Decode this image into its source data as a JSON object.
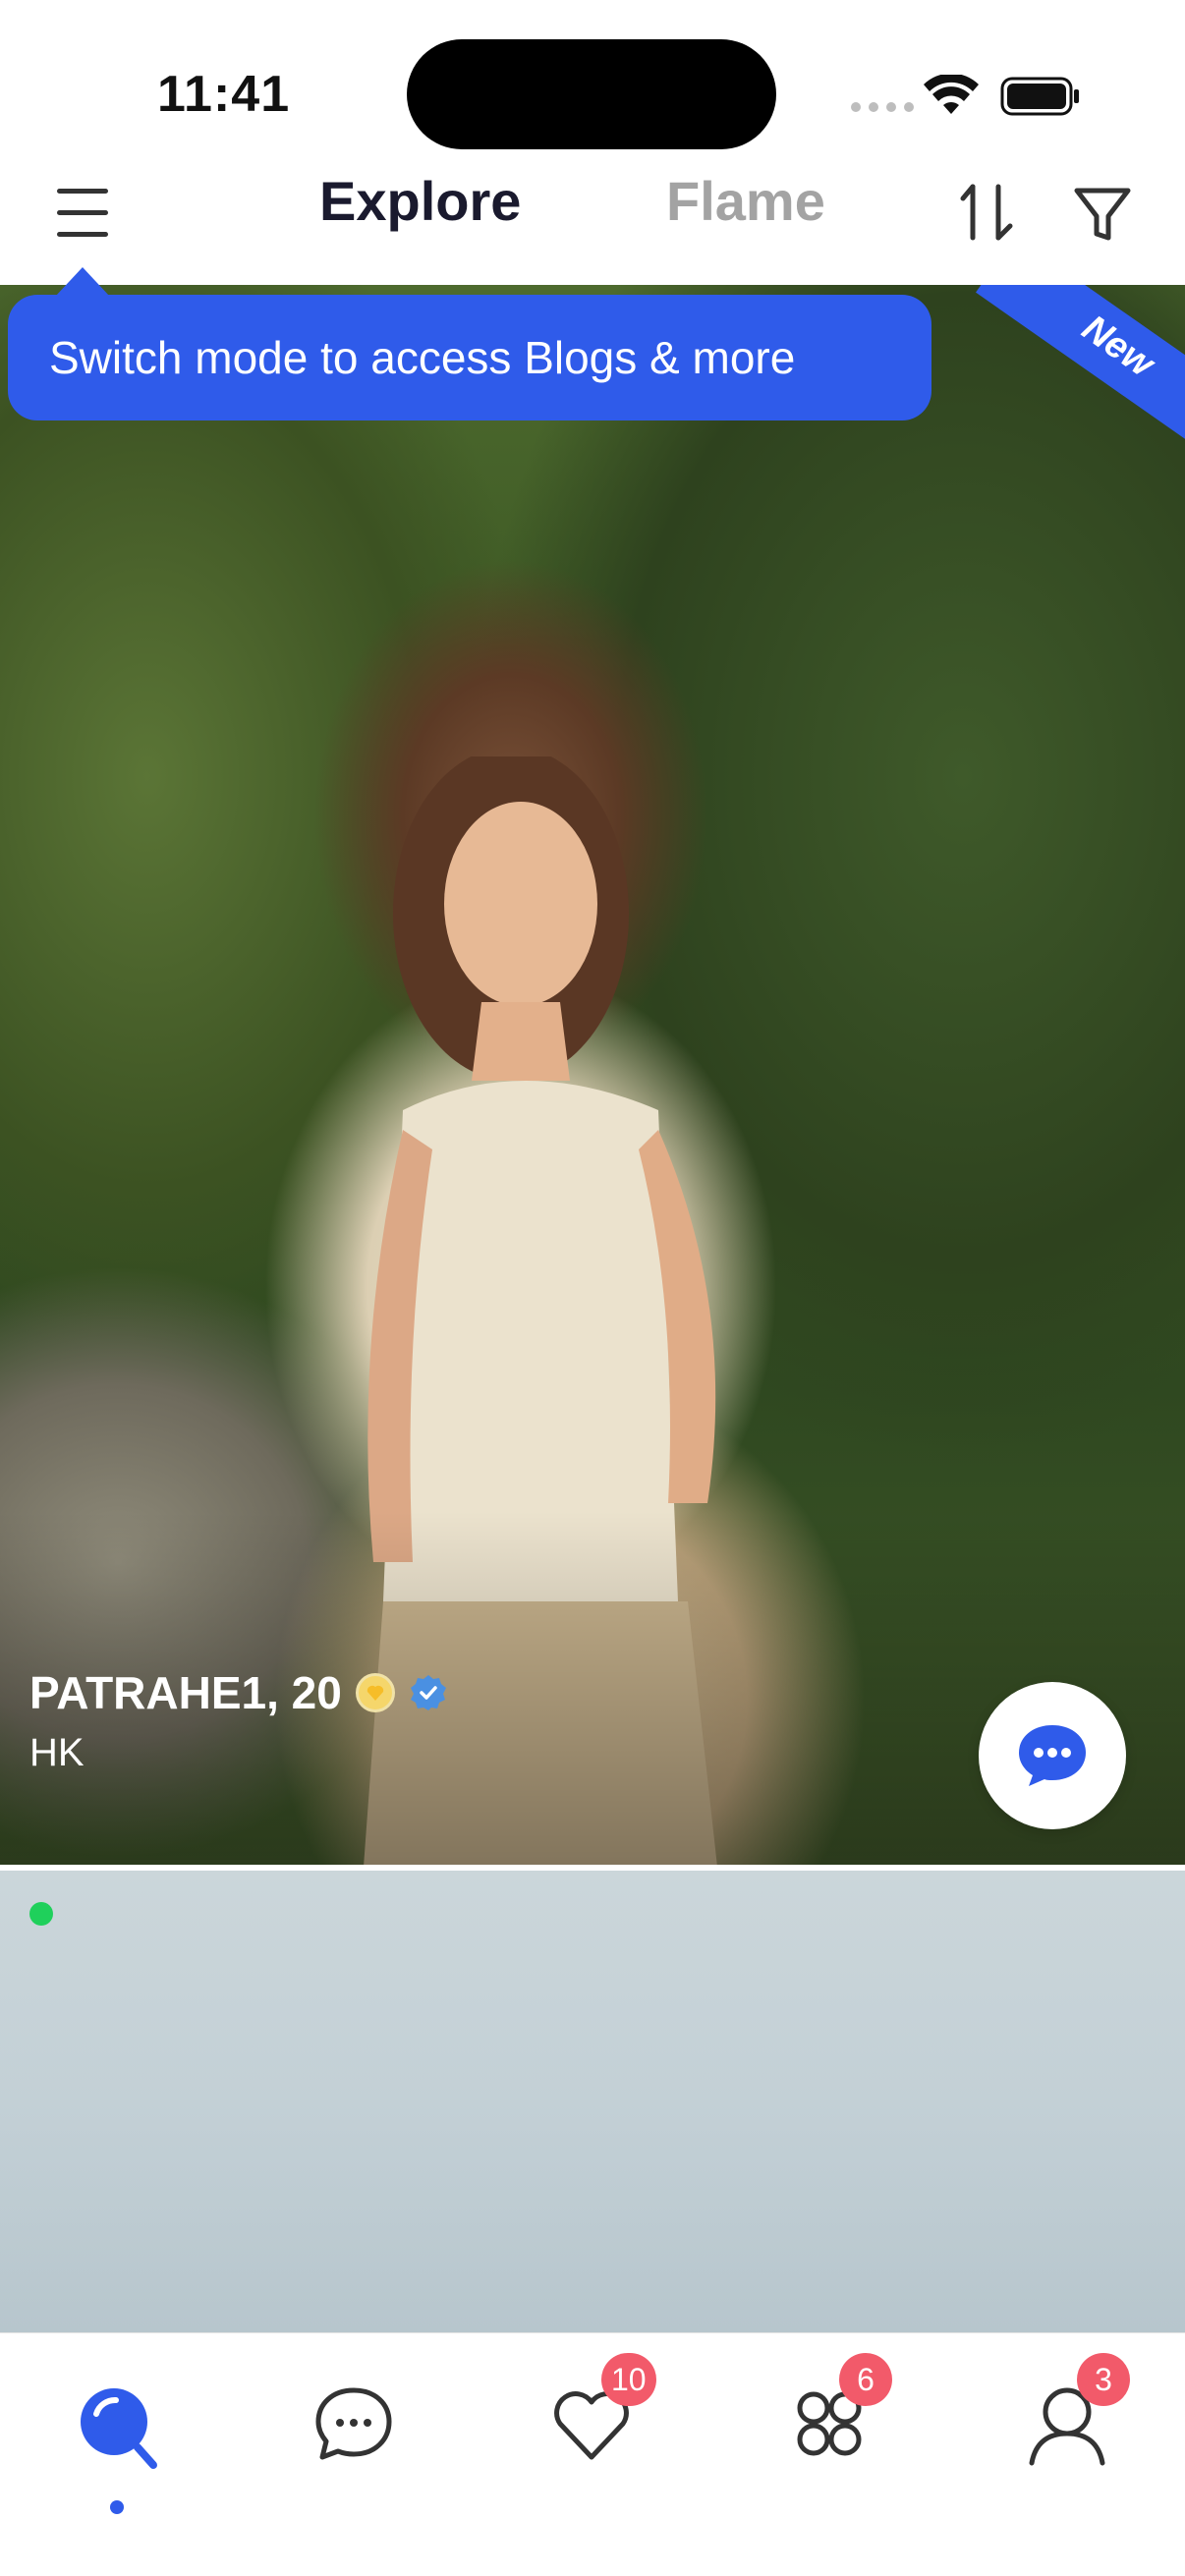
{
  "status_bar": {
    "time": "11:41"
  },
  "top_nav": {
    "tabs": [
      {
        "label": "Explore",
        "active": true
      },
      {
        "label": "Flame",
        "active": false
      }
    ]
  },
  "tooltip": {
    "text": "Switch mode to access Blogs & more"
  },
  "ribbon": {
    "text": "New"
  },
  "profile": {
    "name_age": "PATRAHE1, 20",
    "location": "HK"
  },
  "tab_bar": {
    "items": [
      {
        "icon": "explore-search-icon",
        "active": true,
        "badge": ""
      },
      {
        "icon": "chat-bubble-icon",
        "active": false,
        "badge": ""
      },
      {
        "icon": "heart-icon",
        "active": false,
        "badge": "10"
      },
      {
        "icon": "grid-clover-icon",
        "active": false,
        "badge": "6"
      },
      {
        "icon": "profile-icon",
        "active": false,
        "badge": "3"
      }
    ]
  },
  "colors": {
    "accent": "#2f5bea",
    "badge": "#f25a6a",
    "online": "#1fd05b"
  }
}
